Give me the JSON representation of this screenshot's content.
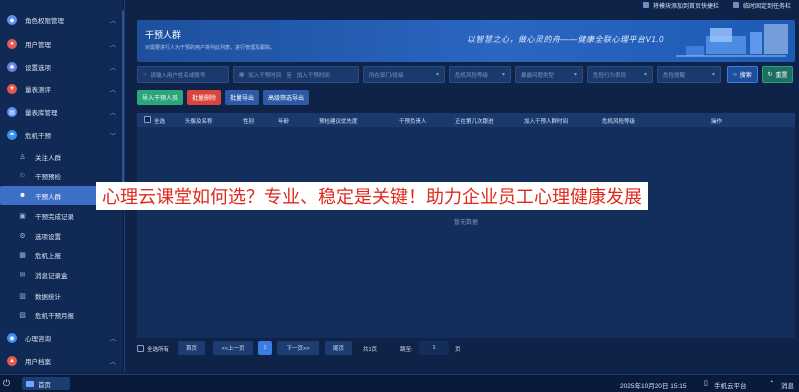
{
  "top_buttons": [
    "将模块添加到首页快捷栏",
    "临时固定到任务栏"
  ],
  "sidebar": {
    "top_items": [
      {
        "label": "角色权限管理",
        "icon": "role-icon",
        "color": "#5b8ff0"
      },
      {
        "label": "用户管理",
        "icon": "user-icon",
        "color": "#e25a5a"
      },
      {
        "label": "设置选项",
        "icon": "settings-icon",
        "color": "#6f7fe0"
      },
      {
        "label": "量表测评",
        "icon": "heart-icon",
        "color": "#e8584e"
      },
      {
        "label": "量表库管理",
        "icon": "library-icon",
        "color": "#5b8ff0"
      },
      {
        "label": "危机干预",
        "icon": "crisis-icon",
        "color": "#3a8ef0"
      }
    ],
    "sub_items": [
      {
        "label": "关注人群",
        "icon": "focus-people-icon"
      },
      {
        "label": "干预预检",
        "icon": "precheck-icon"
      },
      {
        "label": "干预人群",
        "icon": "intervention-people-icon"
      },
      {
        "label": "干预完成记录",
        "icon": "record-icon"
      },
      {
        "label": "选项设置",
        "icon": "gear-icon"
      },
      {
        "label": "危机上报",
        "icon": "report-icon"
      },
      {
        "label": "消息记录盒",
        "icon": "message-box-icon"
      },
      {
        "label": "数据统计",
        "icon": "stats-icon"
      },
      {
        "label": "危机干预月报",
        "icon": "monthly-report-icon"
      }
    ],
    "bottom_items": [
      {
        "label": "心理咨询",
        "icon": "consult-icon",
        "color": "#3a8ef0"
      },
      {
        "label": "用户档案",
        "icon": "profile-icon",
        "color": "#e8584e"
      }
    ]
  },
  "banner": {
    "title": "干预人群",
    "subtitle": "对需要进行人为干预的用户将列此列表，进行管理及跟踪。",
    "slogan": "以智慧之心，做心灵的舟——健康全联心理平台V1.0"
  },
  "filters": {
    "name_placeholder": "请输入用户姓名或账号",
    "date_start": "加入干预时间",
    "date_sep": "至",
    "date_end": "加入干预时间",
    "dept": "所在部门/班级",
    "risk": "危机风险等级",
    "problem": "暴露问题类型",
    "behavior": "危险行为表现",
    "warning": "危险提醒",
    "search": "搜索",
    "reset": "重置"
  },
  "actions": [
    "导入干预人员",
    "批量删除",
    "批量导出",
    "高级筛选导出"
  ],
  "table": {
    "select_all": "全选",
    "columns": [
      "头像及名称",
      "性别",
      "年龄",
      "预检建议优先度",
      "干预负责人",
      "正在第几次跟进",
      "加入干预人群时间",
      "危机风险等级",
      "操作"
    ],
    "empty_text": "暂无数据"
  },
  "pager": {
    "select_all": "全选所有",
    "first": "首页",
    "prev": "<<上一页",
    "current": "1",
    "next": "下一页>>",
    "last": "尾页",
    "total": "共1页",
    "jump_label": "跳至:",
    "jump_value": "1",
    "page_unit": "页"
  },
  "taskbar": {
    "home": "首页",
    "datetime": "2025年10月20日 15:15",
    "mobile": "手机云平台",
    "message": "消息"
  },
  "overlay_text": "心理云课堂如何选？专业、稳定是关键！助力企业员工心理健康发展",
  "colors": {
    "accent_blue": "#3a7be6",
    "delete_red": "#d9443c",
    "import_green": "#2aa67a",
    "reset_green": "#25a37a"
  }
}
